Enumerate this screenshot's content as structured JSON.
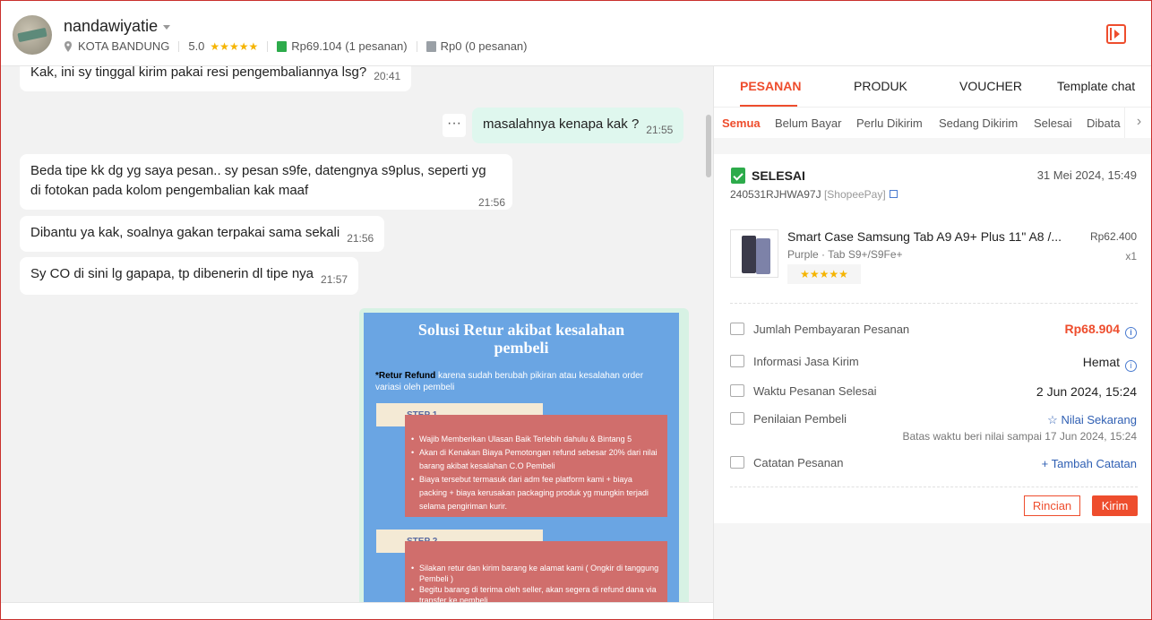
{
  "header": {
    "username": "nandawiyatie",
    "location": "KOTA BANDUNG",
    "rating": "5.0",
    "rating_stars": "★★★★★",
    "paid_amount": "Rp69.104",
    "paid_orders": "(1 pesanan)",
    "unpaid_amount": "Rp0",
    "unpaid_orders": "(0 pesanan)"
  },
  "chat": {
    "messages": [
      {
        "text": "Kak, ini sy tinggal kirim pakai resi pengembaliannya lsg?",
        "time": "20:41"
      },
      {
        "text": "masalahnya kenapa kak ?",
        "time": "21:55"
      },
      {
        "line1": "Beda tipe kk dg yg saya pesan.. sy pesan s9fe, datengnya s9plus, seperti yg",
        "line2": "di fotokan pada kolom pengembalian kak maaf",
        "time": "21:56"
      },
      {
        "text": "Dibantu ya kak, soalnya gakan terpakai sama sekali",
        "time": "21:56"
      },
      {
        "text": "Sy CO di sini lg gapapa, tp dibenerin dl tipe nya",
        "time": "21:57"
      }
    ],
    "more_label": "···",
    "poster": {
      "title_line1": "Solusi Retur akibat kesalahan",
      "title_line2": "pembeli",
      "intro_bold": "*Retur Refund",
      "intro_rest": " karena sudah berubah pikiran atau kesalahan order variasi oleh pembeli",
      "step1_label": "STEP 1",
      "step1_items": [
        "Wajib Memberikan Ulasan Baik Terlebih dahulu & Bintang 5",
        "Akan di Kenakan Biaya Pemotongan refund sebesar 20% dari nilai barang akibat kesalahan C.O Pembeli",
        "Biaya tersebut termasuk dari adm fee platform kami + biaya packing + biaya kerusakan packaging produk yg mungkin terjadi selama pengiriman kurir."
      ],
      "step2_label": "STEP 2",
      "step2_items": [
        "Silakan retur dan kirim barang ke alamat kami ( Ongkir di tanggung Pembeli )",
        "Begitu barang di terima oleh seller, akan segera di refund dana via transfer ke pembeli"
      ]
    }
  },
  "panel": {
    "tabs": [
      "PESANAN",
      "PRODUK",
      "VOUCHER",
      "Template chat"
    ],
    "subtabs": [
      "Semua",
      "Belum Bayar",
      "Perlu Dikirim",
      "Sedang Dikirim",
      "Selesai",
      "Dibata"
    ],
    "subtabs_arrow": "›",
    "order": {
      "status": "SELESAI",
      "date": "31 Mei 2024, 15:49",
      "order_id": "240531RJHWA97J",
      "payment": "[ShopeePay]",
      "product_name": "Smart Case Samsung Tab A9 A9+ Plus 11\" A8 /...",
      "product_variant": "Purple · Tab S9+/S9Fe+",
      "product_price": "Rp62.400",
      "product_qty": "x1",
      "product_stars": "★★★★★",
      "payment_label": "Jumlah Pembayaran Pesanan",
      "payment_value": "Rp68.904",
      "shipping_label": "Informasi Jasa Kirim",
      "shipping_value": "Hemat",
      "completed_label": "Waktu Pesanan Selesai",
      "completed_value": "2 Jun 2024, 15:24",
      "rating_label": "Penilaian Pembeli",
      "rating_value": "Nilai Sekarang",
      "rating_hint": "Batas waktu beri nilai sampai 17 Jun 2024, 15:24",
      "note_label": "Catatan Pesanan",
      "note_value": "Tambah Catatan",
      "btn_detail": "Rincian",
      "btn_send": "Kirim"
    }
  },
  "colors": {
    "accent": "#ee4d2d",
    "link": "#2f5fb3",
    "success": "#2dab4b",
    "my_bubble": "#dff7ee"
  }
}
